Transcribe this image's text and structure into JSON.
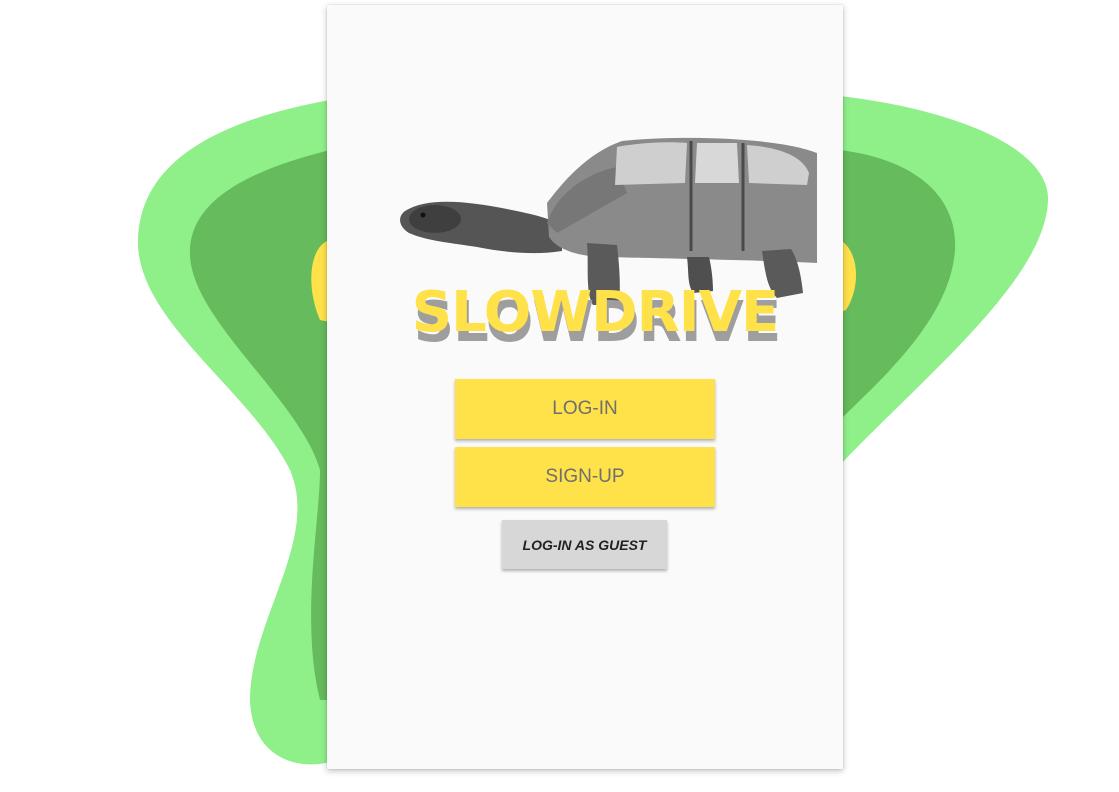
{
  "app": {
    "brand_name": "SLOWDRIVE"
  },
  "buttons": {
    "login_label": "LOG-IN",
    "signup_label": "SIGN-UP",
    "guest_label": "LOG-IN AS GUEST"
  },
  "colors": {
    "accent_yellow": "#ffe14a",
    "blob_light_green": "#8ff08a",
    "blob_dark_green": "#66bb5c",
    "guest_button_gray": "#d7d7d7"
  },
  "icons": {
    "hero_image": "tortoise-car-illustration"
  }
}
